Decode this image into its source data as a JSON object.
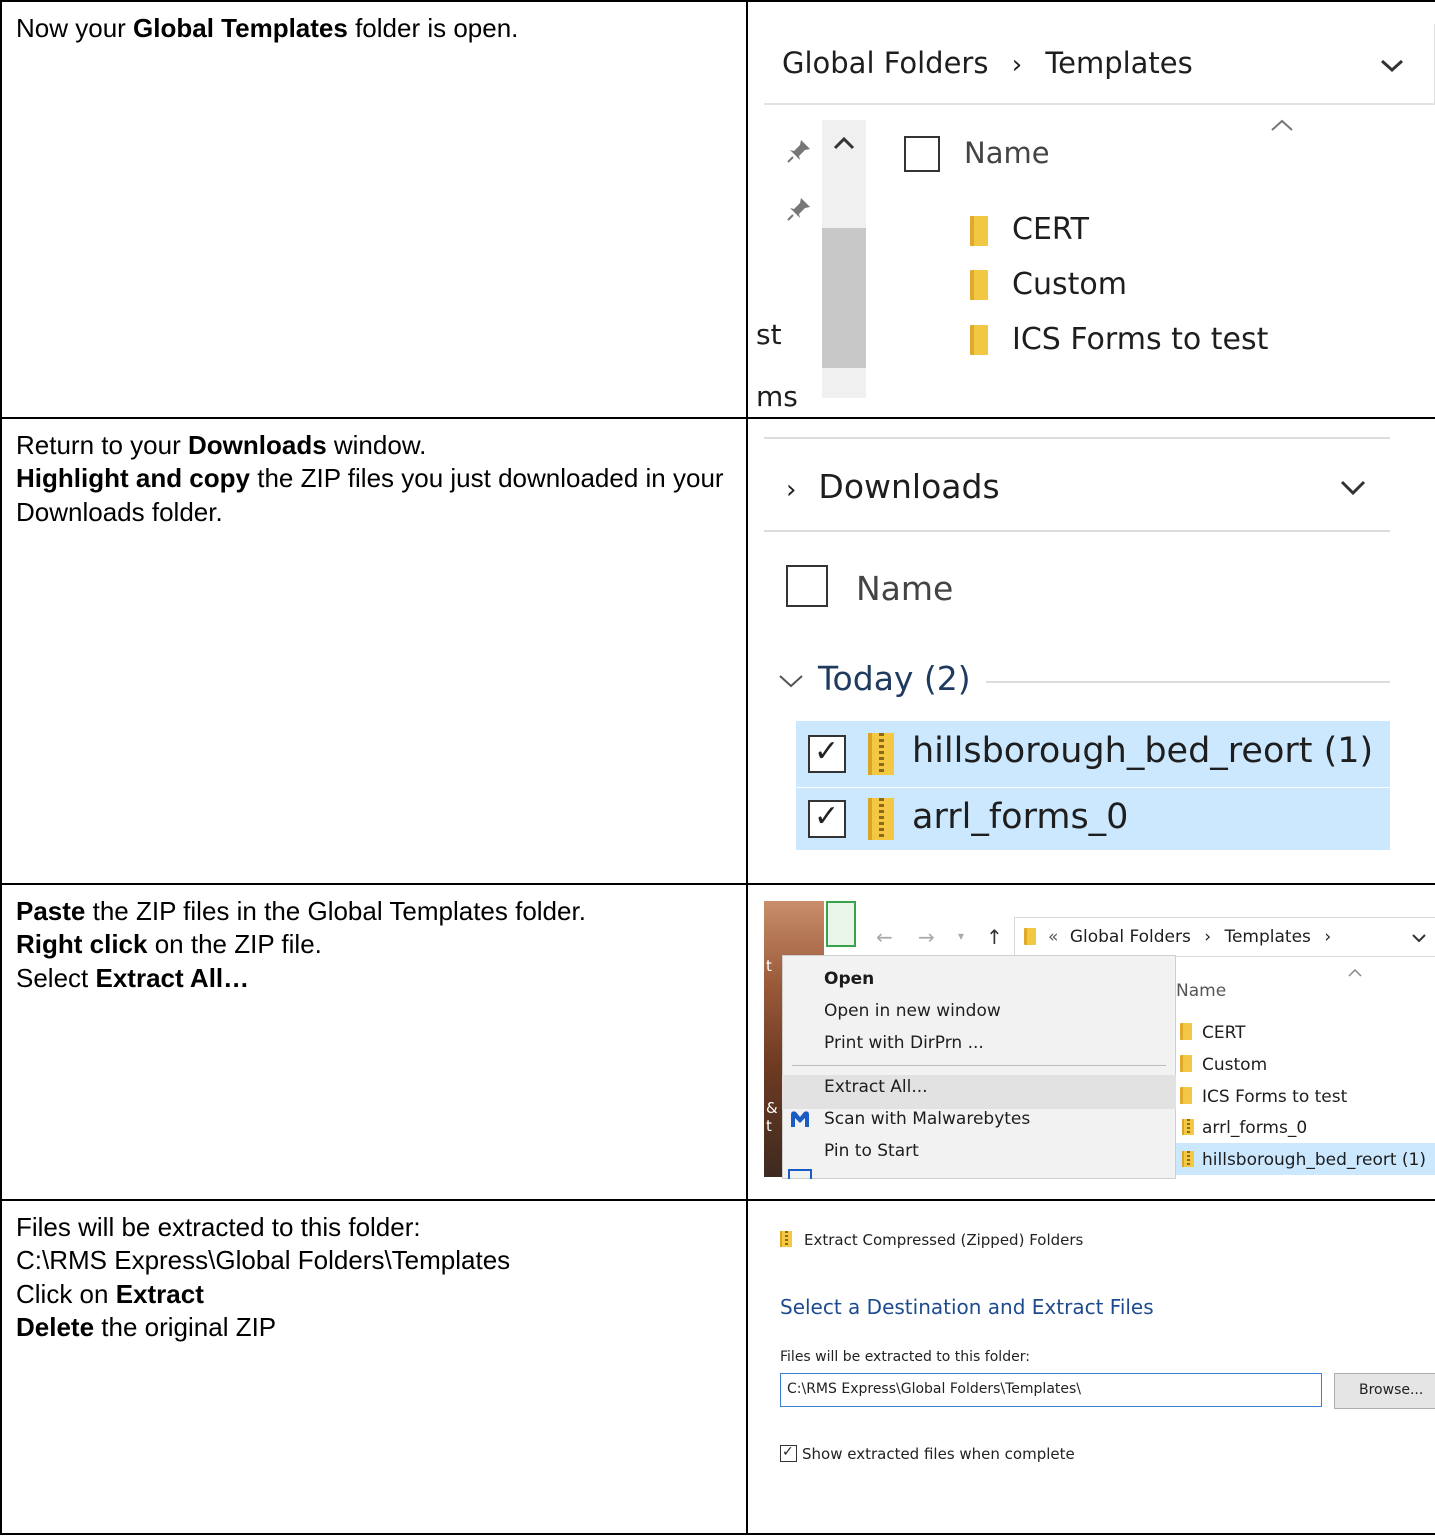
{
  "rows": [
    {
      "instructions": {
        "p1": "Now your ",
        "b1": "Global Templates",
        "p2": " folder is open."
      },
      "screenshot": {
        "breadcrumb": [
          "Global Folders",
          "Templates"
        ],
        "sep": "›",
        "column_header": "Name",
        "folders": [
          "CERT",
          "Custom",
          "ICS Forms to test"
        ],
        "left_fragment_1": "st",
        "left_fragment_2": "ms"
      }
    },
    {
      "instructions": {
        "p1": "Return to your ",
        "b1": "Downloads",
        "p2": " window.",
        "b2": "Highlight and copy",
        "p3": " the ZIP files you just downloaded in your Downloads folder."
      },
      "screenshot": {
        "sep": "›",
        "breadcrumb": "Downloads",
        "column_header": "Name",
        "group": "Today (2)",
        "files": [
          "hillsborough_bed_reort (1)",
          "arrl_forms_0"
        ],
        "check": "✓"
      }
    },
    {
      "instructions": {
        "b1": "Paste",
        "p1": " the ZIP files in the Global Templates folder.",
        "b2": "Right click",
        "p2": " on the ZIP file.",
        "p3": "Select ",
        "b3": "Extract All…"
      },
      "screenshot": {
        "address": {
          "prefix": "«",
          "parts": [
            "Global Folders",
            "Templates"
          ],
          "sep": "›"
        },
        "context_menu": [
          "Open",
          "Open in new window",
          "Print with DirPrn ...",
          "Extract All...",
          "Scan with Malwarebytes",
          "Pin to Start"
        ],
        "column_header": "Name",
        "items": [
          "CERT",
          "Custom",
          "ICS Forms to test",
          "arrl_forms_0",
          "hillsborough_bed_reort (1)"
        ],
        "left_fragment_1": "t",
        "left_fragment_2": "&",
        "left_fragment_3": "t"
      }
    },
    {
      "instructions": {
        "p1": "Files will be extracted to this folder:",
        "p2": "C:\\RMS Express\\Global Folders\\Templates",
        "p3": "Click on ",
        "b1": "Extract",
        "b2": "Delete",
        "p4": " the original ZIP"
      },
      "screenshot": {
        "dialog_title": "Extract Compressed (Zipped) Folders",
        "heading": "Select a Destination and Extract Files",
        "field_label": "Files will be extracted to this folder:",
        "path_value": "C:\\RMS Express\\Global Folders\\Templates\\",
        "browse_label": "Browse...",
        "checkbox_label": "Show extracted files when complete",
        "check": "✓"
      }
    }
  ]
}
